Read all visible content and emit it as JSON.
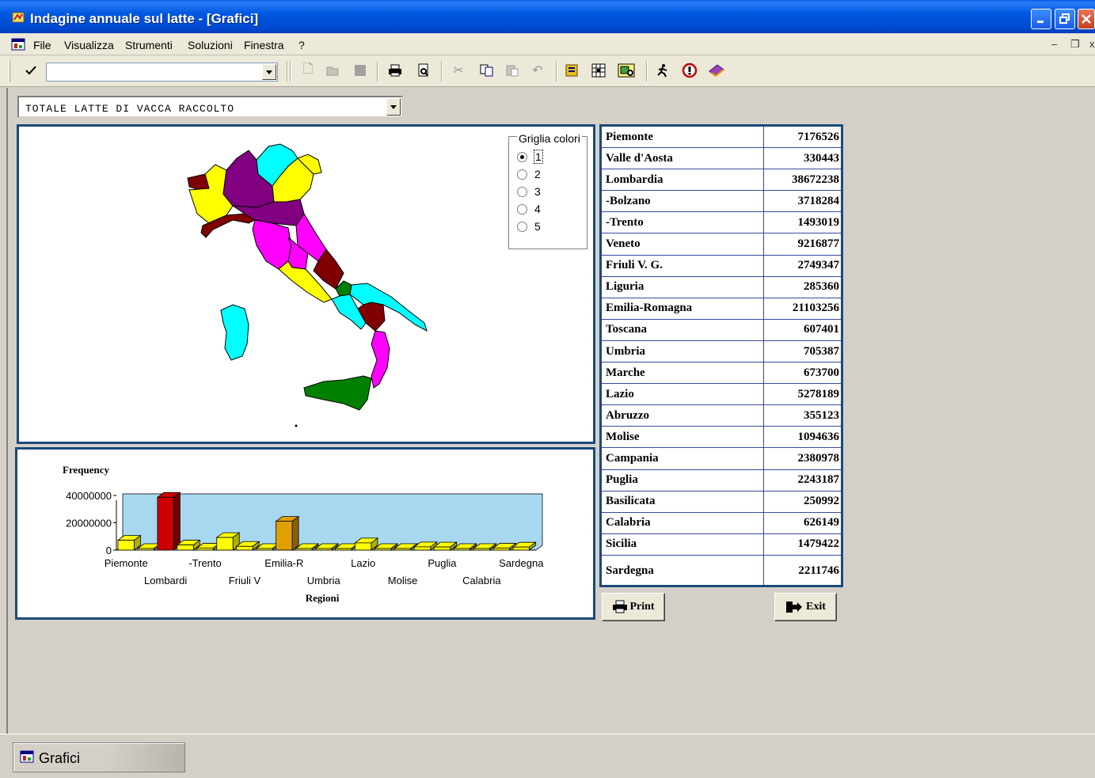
{
  "window": {
    "title": "Indagine annuale sul latte - [Grafici]"
  },
  "menu": [
    "File",
    "Visualizza",
    "Strumenti",
    "Soluzioni",
    "Finestra",
    "?"
  ],
  "toolbar": {
    "combo_value": ""
  },
  "variable_select": {
    "value": "TOTALE LATTE DI VACCA RACCOLTO"
  },
  "color_grid": {
    "legend": "Griglia colori",
    "options": [
      "1",
      "2",
      "3",
      "4",
      "5"
    ],
    "selected": "1"
  },
  "map_colors": {
    "maroon": "#800000",
    "purple": "#800080",
    "magenta": "#ff00ff",
    "cyan": "#00ffff",
    "yellow": "#ffff00",
    "green": "#008000"
  },
  "table": {
    "rows": [
      {
        "region": "Piemonte",
        "value": "7176526"
      },
      {
        "region": "Valle d'Aosta",
        "value": "330443"
      },
      {
        "region": "Lombardia",
        "value": "38672238"
      },
      {
        "region": "-Bolzano",
        "value": "3718284"
      },
      {
        "region": "-Trento",
        "value": "1493019"
      },
      {
        "region": "Veneto",
        "value": "9216877"
      },
      {
        "region": "Friuli V. G.",
        "value": "2749347"
      },
      {
        "region": "Liguria",
        "value": "285360"
      },
      {
        "region": "Emilia-Romagna",
        "value": "21103256"
      },
      {
        "region": "Toscana",
        "value": "607401"
      },
      {
        "region": "Umbria",
        "value": "705387"
      },
      {
        "region": "Marche",
        "value": "673700"
      },
      {
        "region": "Lazio",
        "value": "5278189"
      },
      {
        "region": "Abruzzo",
        "value": "355123"
      },
      {
        "region": "Molise",
        "value": "1094636"
      },
      {
        "region": "Campania",
        "value": "2380978"
      },
      {
        "region": "Puglia",
        "value": "2243187"
      },
      {
        "region": "Basilicata",
        "value": "250992"
      },
      {
        "region": "Calabria",
        "value": "626149"
      },
      {
        "region": "Sicilia",
        "value": "1479422"
      },
      {
        "region": "Sardegna",
        "value": "2211746"
      }
    ]
  },
  "buttons": {
    "print": "Print",
    "exit": "Exit"
  },
  "taskbar": {
    "label": "Grafici"
  },
  "chart_data": {
    "type": "bar",
    "ylabel": "Frequency",
    "xlabel": "Regioni",
    "ylim": [
      0,
      40000000
    ],
    "yticks": [
      "40000000",
      "20000000",
      "0"
    ],
    "categories": [
      "Piemonte",
      "Valle d'Aosta",
      "Lombardi",
      "-Bolzano",
      "-Trento",
      "Veneto",
      "Friuli V",
      "Liguria",
      "Emilia-R",
      "Toscana",
      "Umbria",
      "Marche",
      "Lazio",
      "Abruzzo",
      "Molise",
      "Campania",
      "Puglia",
      "Basilicata",
      "Calabria",
      "Sicilia",
      "Sardegna"
    ],
    "tick_labels_top": [
      "Piemonte",
      "-Trento",
      "Emilia-R",
      "Lazio",
      "Puglia",
      "Sardegna"
    ],
    "tick_labels_bottom": [
      "Lombardi",
      "Friuli V",
      "Umbria",
      "Molise",
      "Calabria"
    ],
    "values": [
      7176526,
      330443,
      38672238,
      3718284,
      1493019,
      9216877,
      2749347,
      285360,
      21103256,
      607401,
      705387,
      673700,
      5278189,
      355123,
      1094636,
      2380978,
      2243187,
      250992,
      626149,
      1479422,
      2211746
    ],
    "bar_colors": {
      "default": "#ffff00",
      "max": "#cc0000",
      "second": "#e0a000"
    },
    "background": "#a8d8f0"
  }
}
